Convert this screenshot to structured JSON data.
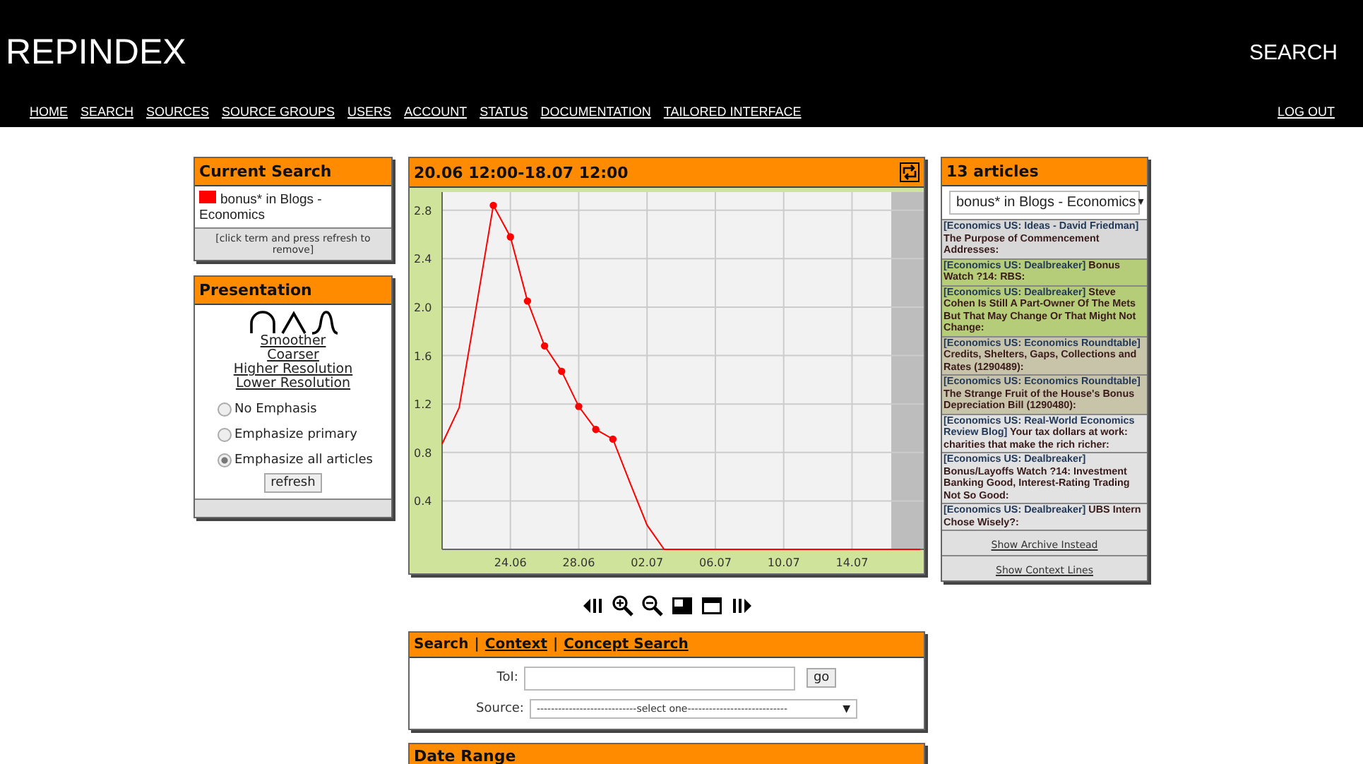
{
  "header": {
    "logo": "REPINDEX",
    "search_link": "SEARCH"
  },
  "nav": {
    "items": [
      "HOME",
      "SEARCH",
      "SOURCES",
      "SOURCE GROUPS",
      "USERS",
      "ACCOUNT",
      "STATUS",
      "DOCUMENTATION",
      "TAILORED INTERFACE"
    ],
    "logout": "LOG OUT"
  },
  "current_search": {
    "title": "Current Search",
    "term": "bonus* in Blogs - Economics",
    "hint": "[click term and press refresh to remove]"
  },
  "presentation": {
    "title": "Presentation",
    "links": [
      "Smoother",
      "Coarser",
      "Higher Resolution",
      "Lower Resolution"
    ],
    "options": [
      {
        "label": "No Emphasis",
        "selected": false
      },
      {
        "label": "Emphasize primary",
        "selected": false
      },
      {
        "label": "Emphasize all articles",
        "selected": true
      }
    ],
    "button": "refresh"
  },
  "chart_panel": {
    "title": "20.06 12:00-18.07 12:00",
    "chart_data": {
      "type": "line",
      "categories": [
        null,
        null,
        null,
        null,
        "24.06",
        null,
        null,
        null,
        "28.06",
        null,
        null,
        null,
        "02.07",
        null,
        null,
        null,
        "06.07",
        null,
        null,
        null,
        "10.07",
        null,
        null,
        null,
        "14.07",
        null,
        null,
        null,
        null
      ],
      "series": [
        {
          "color": "#ff0000",
          "values": [
            0.87,
            1.17,
            2.0,
            2.84,
            2.58,
            2.05,
            1.68,
            1.47,
            1.18,
            0.99,
            0.91,
            0.55,
            0.2,
            0,
            0,
            0,
            0,
            0,
            0,
            0,
            0,
            0,
            0,
            0,
            0,
            0,
            0,
            0,
            0
          ]
        }
      ],
      "ylim": [
        0,
        2.95
      ],
      "grid": true,
      "yticks": [
        {
          "value": 0.4,
          "label": "0.4"
        },
        {
          "value": 0.8,
          "label": "0.8"
        },
        {
          "value": 1.2,
          "label": "1.2"
        },
        {
          "value": 1.6,
          "label": "1.6"
        },
        {
          "value": 2.0,
          "label": "2.0"
        },
        {
          "value": 2.4,
          "label": "2.4"
        },
        {
          "value": 2.8,
          "label": "2.8"
        }
      ]
    }
  },
  "search_panel": {
    "tabs": [
      {
        "label": "Search",
        "selected": true
      },
      {
        "label": "Context",
        "selected": false
      },
      {
        "label": "Concept Search",
        "selected": false
      }
    ],
    "separator": "|",
    "toi_label": "ToI:",
    "go": "go",
    "source_label": "Source:",
    "source_value": "----------------------------select one----------------------------",
    "source_arrow": "▼"
  },
  "date_range": {
    "title": "Date Range"
  },
  "articles": {
    "title": "13 articles",
    "filter": "bonus* in Blogs - Economics",
    "filter_arrow": "▼",
    "items": [
      {
        "source": "[Economics US: Ideas - David Friedman]",
        "title": "The Purpose of Commencement Addresses:",
        "color": "#d8d8d8"
      },
      {
        "source": "[Economics US: Dealbreaker]",
        "title": "Bonus Watch ?14: RBS:",
        "color": "#b5cc78"
      },
      {
        "source": "[Economics US: Dealbreaker]",
        "title": "Steve Cohen Is Still A Part-Owner Of The Mets But That May Change Or That Might Not Change:",
        "color": "#b5cc78"
      },
      {
        "source": "[Economics US: Economics Roundtable]",
        "title": "Credits, Shelters, Gaps, Collections and Rates (1290489):",
        "color": "#c8c4aa"
      },
      {
        "source": "[Economics US: Economics Roundtable]",
        "title": "The Strange Fruit of the House's Bonus Depreciation Bill (1290480):",
        "color": "#c8c4aa"
      },
      {
        "source": "[Economics US: Real-World Economics Review Blog]",
        "title": "Your tax dollars at work: charities that make the rich richer:",
        "color": "#e2e2e2"
      },
      {
        "source": "[Economics US: Dealbreaker]",
        "title": "Bonus/Layoffs Watch ?14: Investment Banking Good, Interest-Rating Trading Not So Good:",
        "color": "#e2e2e2"
      },
      {
        "source": "[Economics US: Dealbreaker]",
        "title": "UBS Intern Chose Wisely?:",
        "color": "#e2e2e2"
      }
    ],
    "footer_links": [
      "Show Archive Instead",
      "Show Context Lines"
    ]
  }
}
